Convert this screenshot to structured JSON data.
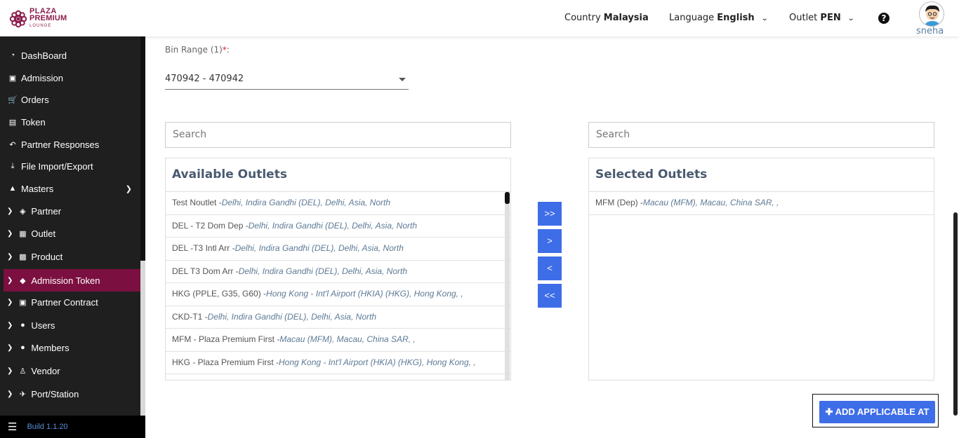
{
  "header": {
    "logo": {
      "line1": "PLAZA",
      "line2": "PREMIUM",
      "line3": "LOUNGE"
    },
    "country_label": "Country",
    "country_value": "Malaysia",
    "language_label": "Language",
    "language_value": "English",
    "outlet_label": "Outlet",
    "outlet_value": "PEN",
    "help_icon": "question-circle-icon",
    "username": "sneha"
  },
  "sidebar": {
    "items": [
      {
        "label": "DashBoard",
        "icon": "dashboard-icon"
      },
      {
        "label": "Admission",
        "icon": "id-card-icon"
      },
      {
        "label": "Orders",
        "icon": "cart-icon"
      },
      {
        "label": "Token",
        "icon": "file-icon"
      },
      {
        "label": "Partner Responses",
        "icon": "reply-icon"
      },
      {
        "label": "File Import/Export",
        "icon": "download-icon"
      },
      {
        "label": "Masters",
        "icon": "sitemap-icon"
      },
      {
        "label": "Partner",
        "icon": "handshake-icon"
      },
      {
        "label": "Outlet",
        "icon": "building-icon"
      },
      {
        "label": "Product",
        "icon": "gift-icon"
      },
      {
        "label": "Admission Token",
        "icon": "tags-icon"
      },
      {
        "label": "Partner Contract",
        "icon": "briefcase-icon"
      },
      {
        "label": "Users",
        "icon": "user-icon"
      },
      {
        "label": "Members",
        "icon": "users-icon"
      },
      {
        "label": "Vendor",
        "icon": "male-icon"
      },
      {
        "label": "Port/Station",
        "icon": "plane-icon"
      }
    ],
    "build": "Build 1.1.20"
  },
  "form": {
    "bin_label": "Bin Range (1)",
    "bin_required": "*",
    "bin_colon": ":",
    "bin_value": "470942 - 470942"
  },
  "available": {
    "search_placeholder": "Search",
    "title": "Available Outlets",
    "rows": [
      {
        "name": "Test Noutlet -",
        "location": "Delhi, Indira Gandhi (DEL), Delhi, Asia, North"
      },
      {
        "name": "DEL - T2 Dom Dep -",
        "location": "Delhi, Indira Gandhi (DEL), Delhi, Asia, North"
      },
      {
        "name": "DEL -T3 Intl Arr -",
        "location": "Delhi, Indira Gandhi (DEL), Delhi, Asia, North"
      },
      {
        "name": "DEL T3 Dom Arr -",
        "location": "Delhi, Indira Gandhi (DEL), Delhi, Asia, North"
      },
      {
        "name": "HKG (PPLE, G35, G60) -",
        "location": "Hong Kong - Int'l Airport (HKIA) (HKG), Hong Kong, ,"
      },
      {
        "name": "CKD-T1 -",
        "location": "Delhi, Indira Gandhi (DEL), Delhi, Asia, North"
      },
      {
        "name": "MFM - Plaza Premium First -",
        "location": "Macau (MFM), Macau, China SAR, ,"
      },
      {
        "name": "HKG - Plaza Premium First -",
        "location": "Hong Kong - Int'l Airport (HKIA) (HKG), Hong Kong, ,"
      }
    ]
  },
  "selected": {
    "search_placeholder": "Search",
    "title": "Selected Outlets",
    "rows": [
      {
        "name": "MFM (Dep) -",
        "location": "Macau (MFM), Macau, China SAR, ,"
      }
    ]
  },
  "move_buttons": {
    "add_all": ">>",
    "add": ">",
    "remove": "<",
    "remove_all": "<<"
  },
  "add_applicable": {
    "icon": "plus-icon",
    "label": "ADD APPLICABLE AT"
  }
}
